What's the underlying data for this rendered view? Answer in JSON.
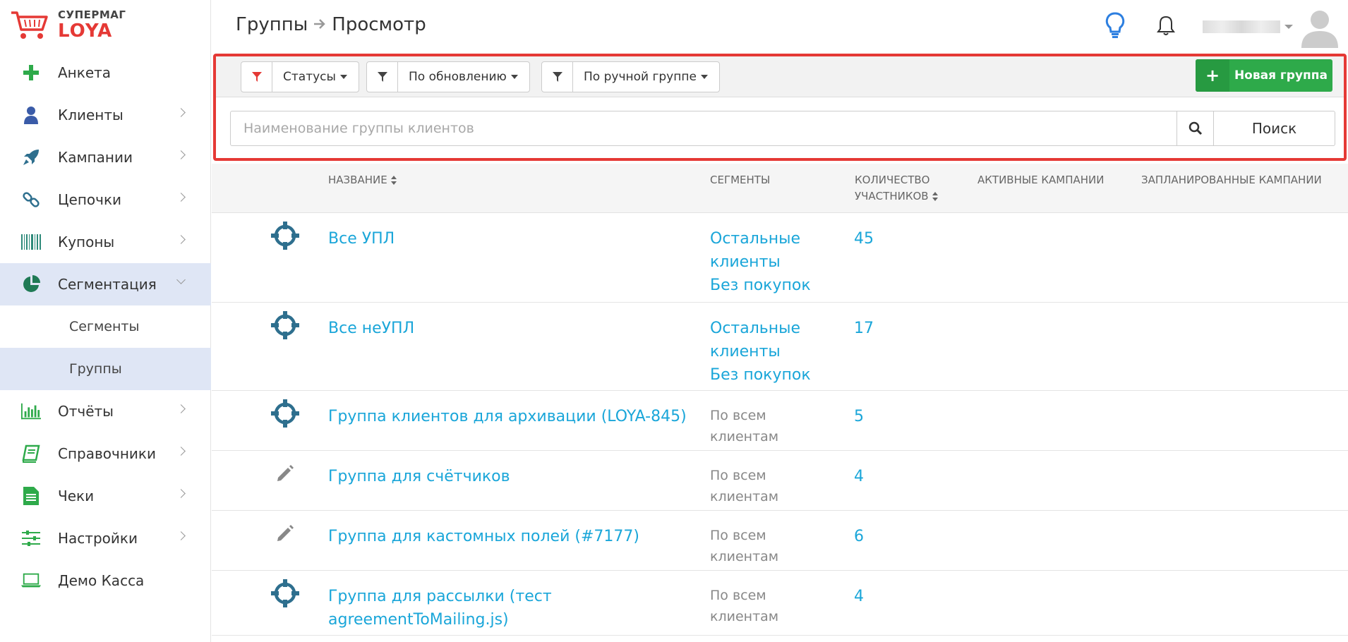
{
  "brand": {
    "line1": "СУПЕРМАГ",
    "line2": "LOYA"
  },
  "sidebar": {
    "items": [
      {
        "label": "Анкета",
        "icon": "plus-icon",
        "color": "#2eaa4a"
      },
      {
        "label": "Клиенты",
        "icon": "user-icon",
        "color": "#3a5ba8"
      },
      {
        "label": "Кампании",
        "icon": "rocket-icon",
        "color": "#2e6f8e"
      },
      {
        "label": "Цепочки",
        "icon": "link-icon",
        "color": "#2e6f8e"
      },
      {
        "label": "Купоны",
        "icon": "barcode-icon",
        "color": "#2e8a7a"
      },
      {
        "label": "Сегментация",
        "icon": "pie-chart-icon",
        "color": "#1f7a55"
      },
      {
        "label": "Сегменты"
      },
      {
        "label": "Группы"
      },
      {
        "label": "Отчёты",
        "icon": "bar-chart-icon",
        "color": "#2eaa4a"
      },
      {
        "label": "Справочники",
        "icon": "book-icon",
        "color": "#2eaa4a"
      },
      {
        "label": "Чеки",
        "icon": "document-icon",
        "color": "#2eaa4a"
      },
      {
        "label": "Настройки",
        "icon": "sliders-icon",
        "color": "#2eaa4a"
      },
      {
        "label": "Демо Касса",
        "icon": "laptop-icon",
        "color": "#2eaa4a"
      }
    ]
  },
  "header": {
    "breadcrumb": [
      "Группы",
      "Просмотр"
    ],
    "icons": [
      "lightbulb-icon",
      "bell-icon",
      "avatar"
    ]
  },
  "filters": {
    "statuses": "Статусы",
    "by_update": "По обновлению",
    "by_manual_group": "По ручной группе",
    "new_group": "Новая группа",
    "search_placeholder": "Наименование группы клиентов",
    "search_button": "Поиск"
  },
  "table": {
    "columns": {
      "name": "НАЗВАНИЕ",
      "segments": "СЕГМЕНТЫ",
      "count_line1": "КОЛИЧЕСТВО",
      "count_line2": "УЧАСТНИКОВ",
      "active": "АКТИВНЫЕ КАМПАНИИ",
      "planned": "ЗАПЛАНИРОВАННЫЕ КАМПАНИИ"
    },
    "rows": [
      {
        "icon": "target-icon",
        "name": "Все УПЛ",
        "segments": [
          "Остальные клиенты",
          "Без покупок"
        ],
        "segments_style": "link",
        "count": "45"
      },
      {
        "icon": "target-icon",
        "name": "Все неУПЛ",
        "segments": [
          "Остальные клиенты",
          "Без покупок"
        ],
        "segments_style": "link",
        "count": "17"
      },
      {
        "icon": "target-icon",
        "name": "Группа клиентов для архивации (LOYA-845)",
        "segments": [
          "По всем клиентам"
        ],
        "segments_style": "plain",
        "count": "5"
      },
      {
        "icon": "pencil-icon",
        "name": "Группа для счётчиков",
        "segments": [
          "По всем клиентам"
        ],
        "segments_style": "plain",
        "count": "4"
      },
      {
        "icon": "pencil-icon",
        "name": "Группа для кастомных полей (#7177)",
        "segments": [
          "По всем клиентам"
        ],
        "segments_style": "plain",
        "count": "6"
      },
      {
        "icon": "target-icon",
        "name": "Группа для рассылки (тест agreementToMailing.js)",
        "segments": [
          "По всем клиентам"
        ],
        "segments_style": "plain",
        "count": "4"
      }
    ]
  },
  "colors": {
    "accent": "#1aa6d9",
    "highlight_border": "#e53935",
    "new_button": "#2eaa4a",
    "active_menu_bg": "#dfe6f5"
  }
}
